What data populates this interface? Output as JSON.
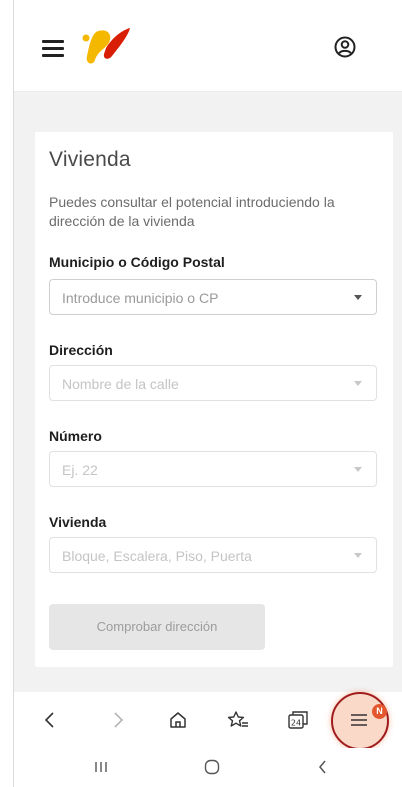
{
  "header": {
    "menu_icon": "hamburger-menu-icon",
    "logo": "brand-logo",
    "user_icon": "user-account-icon",
    "colors": {
      "logo_yellow": "#f5b800",
      "logo_red": "#d81e05"
    }
  },
  "form": {
    "title": "Vivienda",
    "description": "Puedes consultar el potencial introduciendo la dirección de la vivienda",
    "fields": [
      {
        "label": "Municipio o Código Postal",
        "placeholder": "Introduce municipio o CP",
        "enabled": true
      },
      {
        "label": "Dirección",
        "placeholder": "Nombre de la calle",
        "enabled": false
      },
      {
        "label": "Número",
        "placeholder": "Ej. 22",
        "enabled": false
      },
      {
        "label": "Vivienda",
        "placeholder": "Bloque, Escalera, Piso, Puerta",
        "enabled": false
      }
    ],
    "submit_label": "Comprobar dirección",
    "submit_enabled": false
  },
  "browser_toolbar": {
    "items": [
      "back-icon",
      "forward-icon",
      "home-icon",
      "bookmarks-icon",
      "tabs-icon",
      "menu-icon"
    ],
    "tabs_count": "24",
    "menu_badge": "N",
    "colors": {
      "badge": "#e4572e",
      "highlight_ring": "#a11d1d"
    }
  },
  "system_nav": {
    "items": [
      "recent-apps-icon",
      "home-circle-icon",
      "back-chevron-icon"
    ]
  }
}
